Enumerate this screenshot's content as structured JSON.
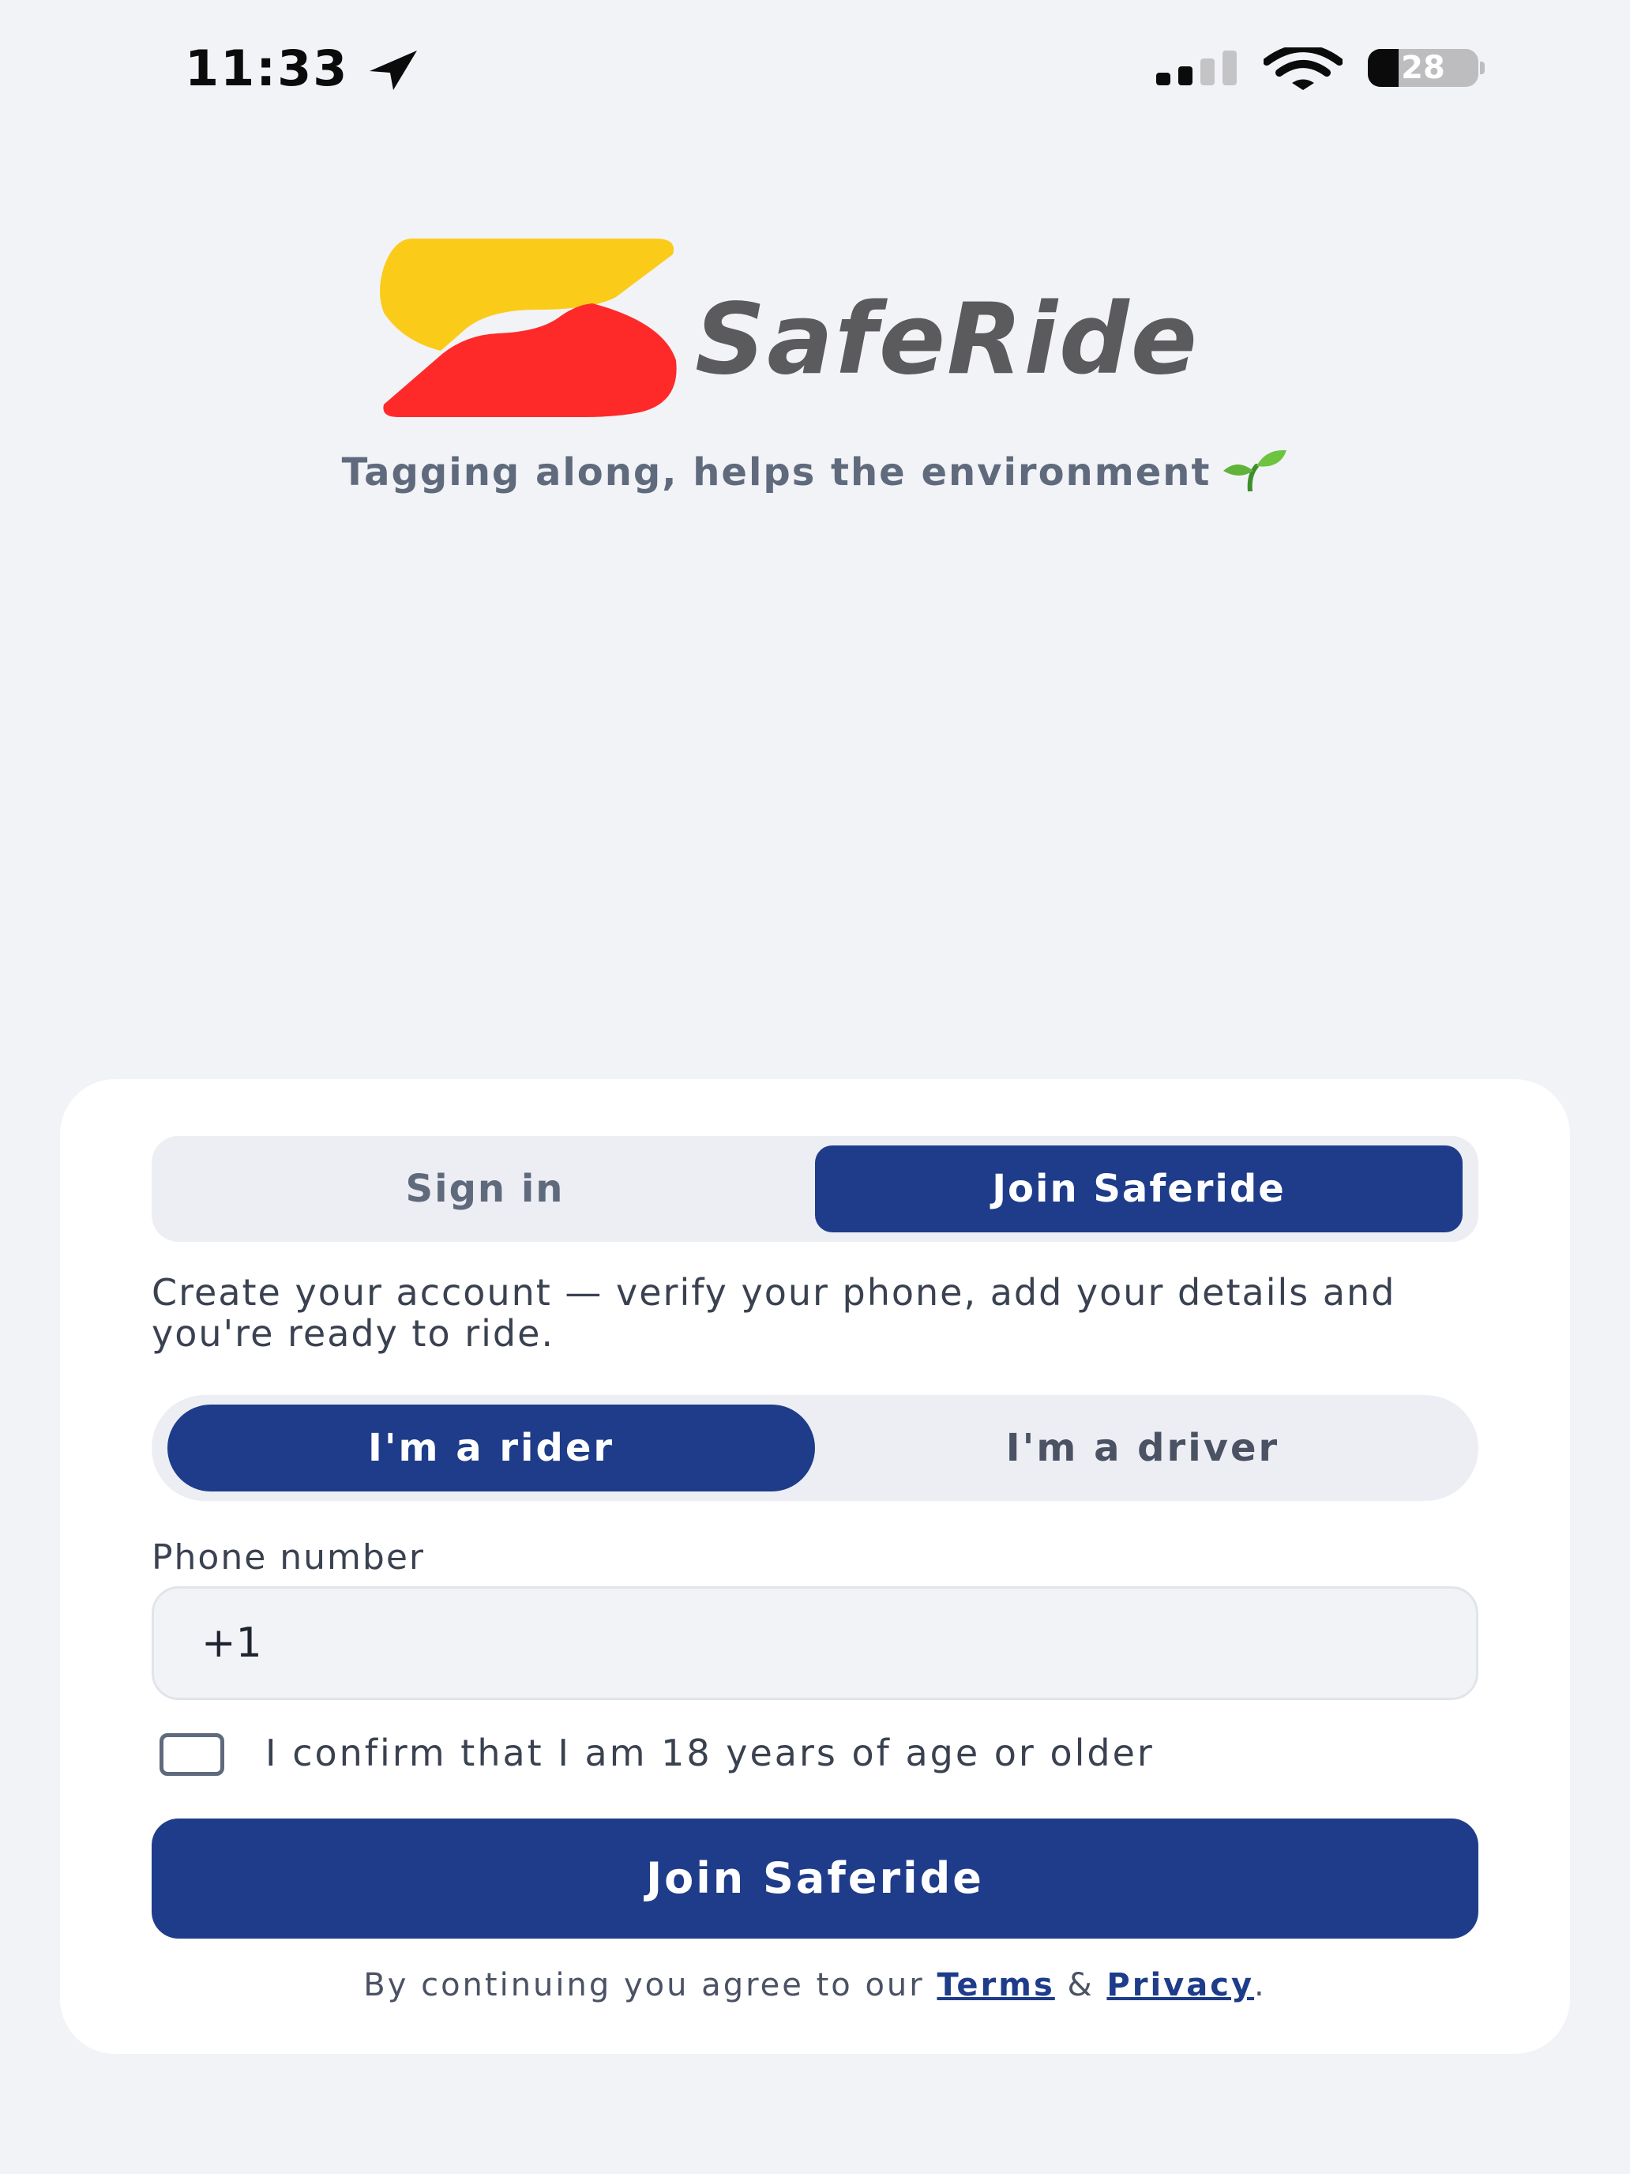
{
  "status_bar": {
    "time": "11:33",
    "battery_percent": "28",
    "battery_level": 0.28
  },
  "brand": {
    "name": "SafeRide",
    "tagline": "Tagging along, helps the environment",
    "colors": {
      "yellow": "#fbcb1a",
      "red": "#fd2a29",
      "wordmark": "#5b5b5e"
    }
  },
  "auth_tabs": {
    "sign_in": "Sign in",
    "join": "Join Saferide",
    "active": "join"
  },
  "intro_text": "Create your account — verify your phone, add your details and you're ready to ride.",
  "role_toggle": {
    "rider": "I'm a rider",
    "driver": "I'm a driver",
    "active": "rider"
  },
  "phone": {
    "label": "Phone number",
    "value": "+1"
  },
  "age_confirm": {
    "label": "I confirm that I am 18 years of age or older",
    "checked": false
  },
  "submit_label": "Join Saferide",
  "legal": {
    "prefix": "By continuing you agree to our",
    "terms": "Terms",
    "separator": "&",
    "privacy": "Privacy",
    "suffix": "."
  },
  "theme": {
    "primary": "#1e3c8a",
    "background": "#f2f3f7",
    "card": "#ffffff",
    "segment_bg": "#eceef3"
  },
  "icons": {
    "location": "location-arrow-icon",
    "signal": "cellular-signal-icon",
    "wifi": "wifi-icon",
    "battery": "battery-icon",
    "sprout": "seedling-icon"
  }
}
